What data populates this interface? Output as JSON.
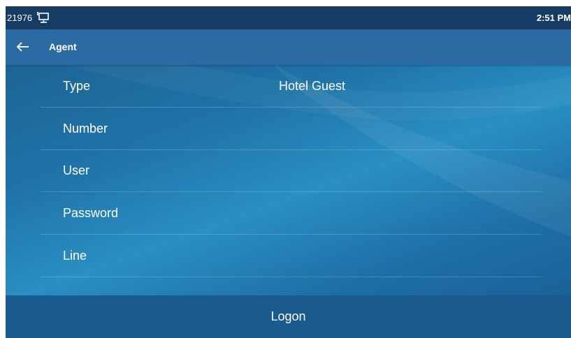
{
  "status_bar": {
    "extension": "21976",
    "network_icon": "network-monitor-icon",
    "time": "2:51 PM"
  },
  "title_bar": {
    "back_icon": "back-arrow-icon",
    "title": "Agent"
  },
  "form": {
    "rows": [
      {
        "label": "Type",
        "value": "Hotel Guest"
      },
      {
        "label": "Number",
        "value": ""
      },
      {
        "label": "User",
        "value": ""
      },
      {
        "label": "Password",
        "value": ""
      },
      {
        "label": "Line",
        "value": ""
      }
    ]
  },
  "actions": {
    "logon_label": "Logon"
  },
  "colors": {
    "status_bar": "#163c63",
    "title_bar": "#2b6aa3",
    "background": "#1f73a8",
    "logon_bar": "#1a5a8e"
  }
}
